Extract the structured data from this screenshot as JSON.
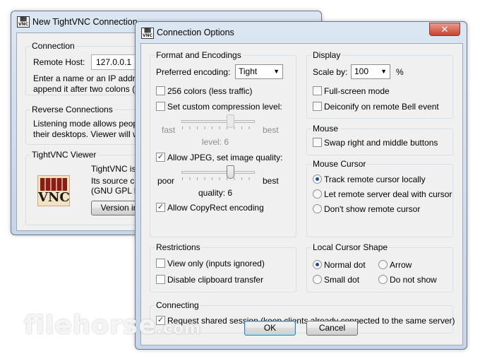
{
  "back_window": {
    "title": "New TightVNC Connection",
    "connection": {
      "group_label": "Connection",
      "remote_host_label": "Remote Host:",
      "remote_host_value": "127.0.0.1",
      "hint_line1": "Enter a name or an IP address",
      "hint_line2": "append it after two colons (fo"
    },
    "reverse": {
      "group_label": "Reverse Connections",
      "line1": "Listening mode allows people t",
      "line2": "their desktops. Viewer will wai"
    },
    "viewer": {
      "group_label": "TightVNC Viewer",
      "logo_text": "VNC",
      "line1": "TightVNC is cr",
      "line2": "Its source coc",
      "line3": "(GNU GPL lice",
      "version_button": "Version info"
    }
  },
  "dialog": {
    "title": "Connection Options",
    "format": {
      "group_label": "Format and Encodings",
      "preferred_label": "Preferred encoding:",
      "preferred_value": "Tight",
      "colors256": "256 colors (less traffic)",
      "colors256_checked": false,
      "custom_compression": "Set custom compression level:",
      "custom_compression_checked": false,
      "fast": "fast",
      "best": "best",
      "compression_level_text": "level: 6",
      "compression_level": 6,
      "allow_jpeg": "Allow JPEG, set image quality:",
      "allow_jpeg_checked": true,
      "poor": "poor",
      "best2": "best",
      "quality_text": "quality: 6",
      "quality_level": 6,
      "copyrect": "Allow CopyRect encoding",
      "copyrect_checked": true
    },
    "display": {
      "group_label": "Display",
      "scale_label": "Scale by:",
      "scale_value": "100",
      "scale_unit": "%",
      "fullscreen": "Full-screen mode",
      "fullscreen_checked": false,
      "deiconify": "Deiconify on remote Bell event",
      "deiconify_checked": false
    },
    "mouse": {
      "group_label": "Mouse",
      "swap": "Swap right and middle buttons",
      "swap_checked": false
    },
    "mouse_cursor": {
      "group_label": "Mouse Cursor",
      "options": [
        "Track remote cursor locally",
        "Let remote server deal with cursor",
        "Don't show remote cursor"
      ],
      "selected": 0
    },
    "restrictions": {
      "group_label": "Restrictions",
      "view_only": "View only (inputs ignored)",
      "view_only_checked": false,
      "disable_clipboard": "Disable clipboard transfer",
      "disable_clipboard_checked": false
    },
    "local_cursor": {
      "group_label": "Local Cursor Shape",
      "normal_dot": "Normal dot",
      "arrow": "Arrow",
      "small_dot": "Small dot",
      "do_not_show": "Do not show",
      "selected": "normal_dot"
    },
    "connecting": {
      "group_label": "Connecting",
      "shared": "Request shared session (keep clients already connected to the same server)",
      "shared_checked": true
    },
    "ok_label": "OK",
    "cancel_label": "Cancel"
  },
  "watermark": {
    "text": "filehorse",
    "suffix": ".com"
  },
  "colors": {
    "title_bar": "#c5d6e8",
    "client": "#f0f0f0",
    "radio_dot": "#1c4f9c",
    "close_button": "#c7442f"
  }
}
